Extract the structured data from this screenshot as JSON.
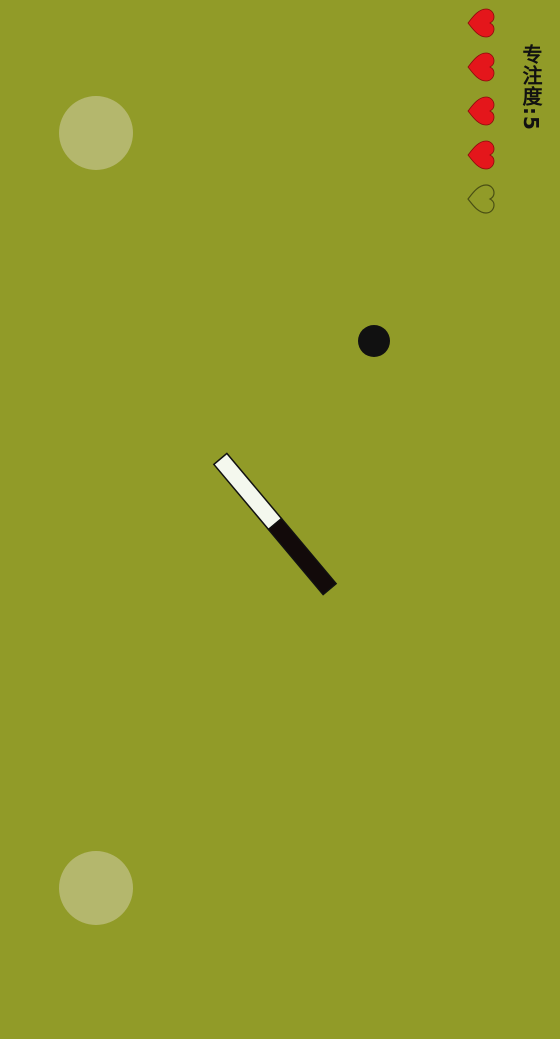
{
  "hud": {
    "focus_label": "专注度:",
    "focus_value": "5",
    "hearts_total": 5,
    "hearts_filled": 4,
    "heart_color": "#e4161b",
    "heart_empty_stroke": "#4a4f14"
  },
  "colors": {
    "background": "#919b28",
    "ball": "#111111",
    "stick_light": "#f4f8ee",
    "stick_dark": "#120a0a"
  },
  "icons": {
    "heart_full": "heart-filled-icon",
    "heart_empty": "heart-outline-icon"
  }
}
